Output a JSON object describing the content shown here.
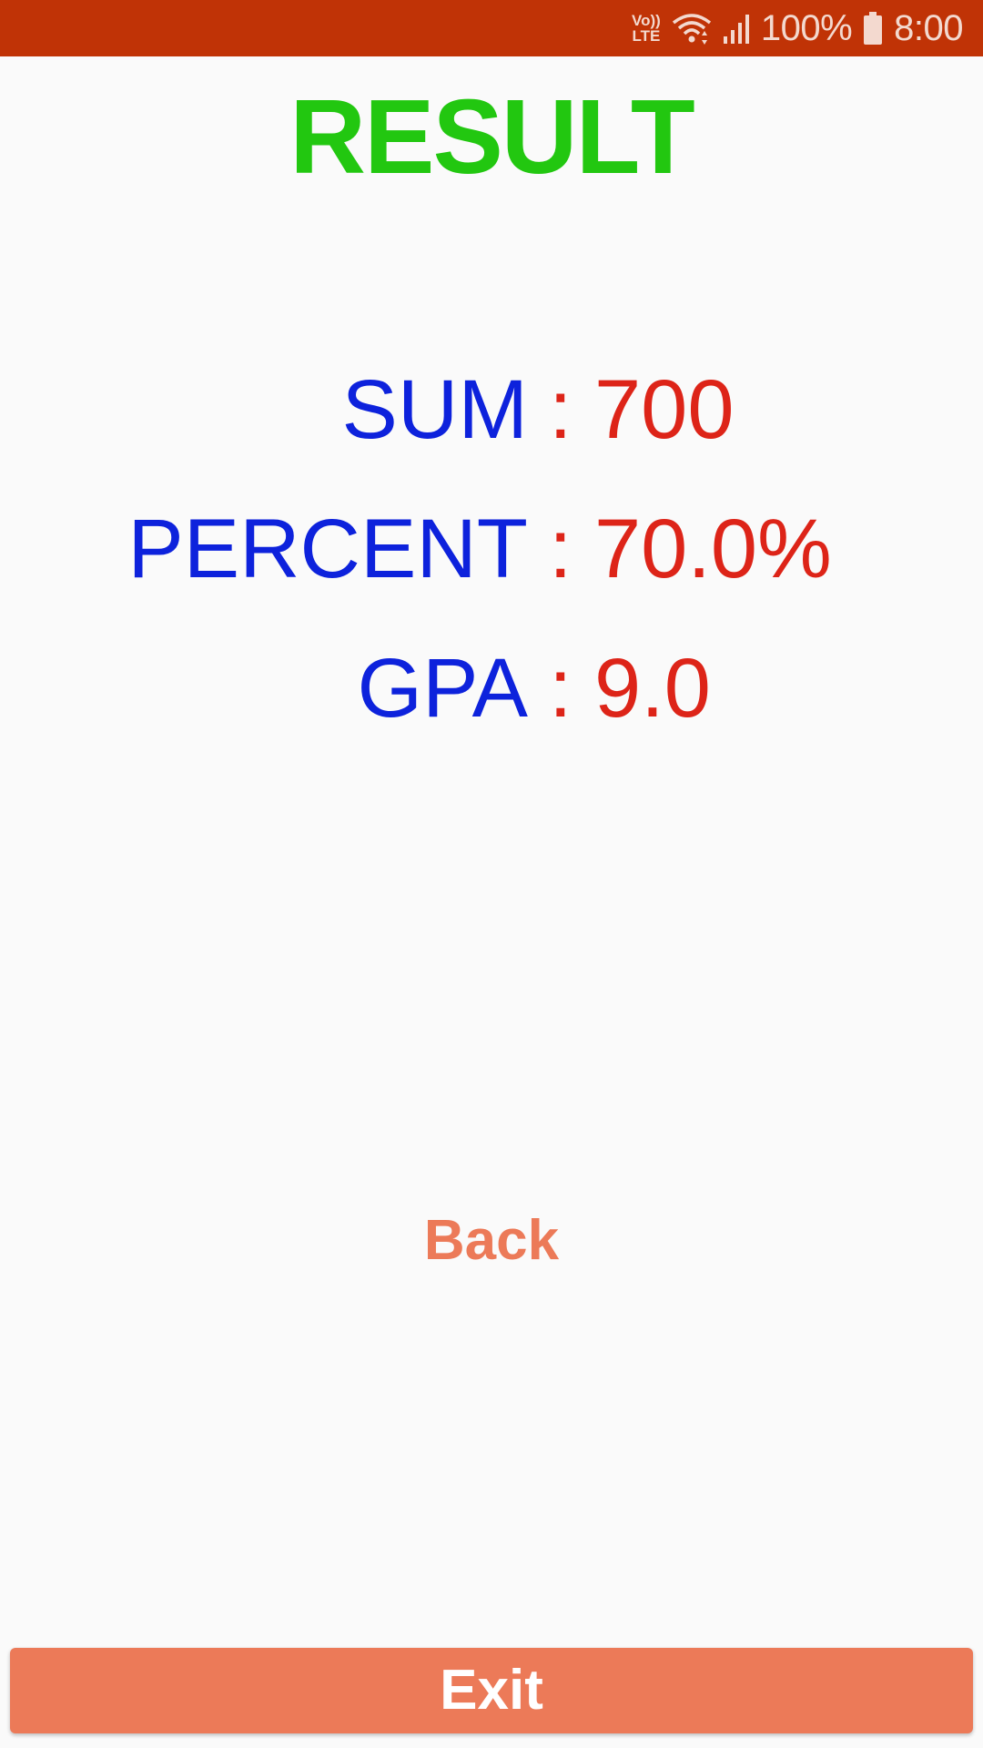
{
  "status_bar": {
    "volte_top": "Vo))",
    "volte_bottom": "LTE",
    "battery": "100%",
    "time": "8:00",
    "icons": [
      "volte-icon",
      "wifi-icon",
      "signal-icon",
      "battery-icon"
    ],
    "background": "#c03306"
  },
  "title": "RESULT",
  "results": {
    "sum": {
      "label": "SUM",
      "separator": ":",
      "value": "700"
    },
    "percent": {
      "label": "PERCENT",
      "separator": ":",
      "value": "70.0%"
    },
    "gpa": {
      "label": "GPA",
      "separator": ":",
      "value": "9.0"
    }
  },
  "buttons": {
    "back_label": "Back",
    "exit_label": "Exit"
  },
  "colors": {
    "title": "#22c710",
    "label": "#0d22dc",
    "value": "#dd2418",
    "button_accent": "#ec7a58"
  }
}
